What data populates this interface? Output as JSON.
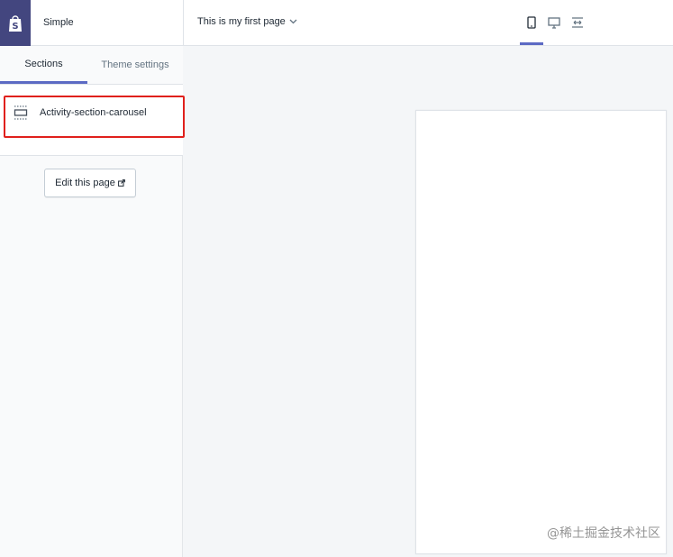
{
  "app": {
    "theme_name": "Simple",
    "logo_icon": "shopify-bag-icon",
    "brand_color": "#43467f",
    "accent_color": "#5c6ac4"
  },
  "header": {
    "page_selector": {
      "label": "This is my first page",
      "icon": "chevron-down-icon"
    },
    "device_toggles": [
      {
        "name": "mobile",
        "icon": "mobile-icon",
        "active": true
      },
      {
        "name": "desktop",
        "icon": "desktop-icon",
        "active": false
      },
      {
        "name": "fullscreen",
        "icon": "fullscreen-icon",
        "active": false
      }
    ]
  },
  "sidebar": {
    "tabs": [
      {
        "label": "Sections",
        "active": true
      },
      {
        "label": "Theme settings",
        "active": false
      }
    ],
    "sections": [
      {
        "label": "Activity-section-carousel",
        "icon": "section-icon",
        "highlighted": true,
        "highlight_color": "#e0201c"
      }
    ],
    "edit_button": {
      "label": "Edit this page",
      "icon": "external-link-icon"
    }
  },
  "watermark": "@稀土掘金技术社区"
}
